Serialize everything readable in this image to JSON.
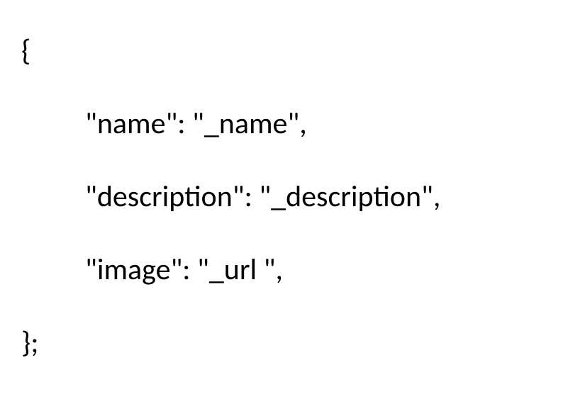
{
  "code": {
    "brace_open": "{",
    "line1": "\"name\": \"_name\",",
    "line2": "\"description\": \"_description\",",
    "line3": "\"image\": \"_url \",",
    "brace_close": "};"
  }
}
